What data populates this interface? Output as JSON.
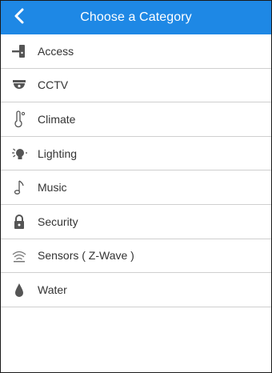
{
  "header": {
    "title": "Choose a Category",
    "back_icon": "chevron-left-icon",
    "background": "#1e88e5"
  },
  "categories": [
    {
      "label": "Access",
      "icon": "door-lock-icon"
    },
    {
      "label": "CCTV",
      "icon": "camera-dome-icon"
    },
    {
      "label": "Climate",
      "icon": "thermometer-icon"
    },
    {
      "label": "Lighting",
      "icon": "lightbulb-icon"
    },
    {
      "label": "Music",
      "icon": "music-note-icon"
    },
    {
      "label": "Security",
      "icon": "padlock-icon"
    },
    {
      "label": "Sensors ( Z-Wave )",
      "icon": "wireless-signal-icon"
    },
    {
      "label": "Water",
      "icon": "water-drop-icon"
    }
  ]
}
